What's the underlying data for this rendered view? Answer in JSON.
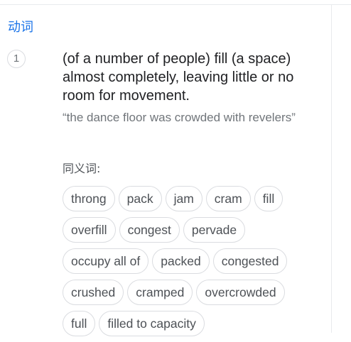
{
  "pos_label": "动词",
  "sense": {
    "number": "1",
    "definition": "(of a number of people) fill (a space) almost completely, leaving little or no room for movement.",
    "example": "“the dance floor was crowded with revelers”"
  },
  "synonyms_label": "同义词:",
  "synonyms": [
    "throng",
    "pack",
    "jam",
    "cram",
    "fill",
    "overfill",
    "congest",
    "pervade",
    "occupy all of",
    "packed",
    "congested",
    "crushed",
    "cramped",
    "overcrowded",
    "full",
    "filled to capacity"
  ]
}
